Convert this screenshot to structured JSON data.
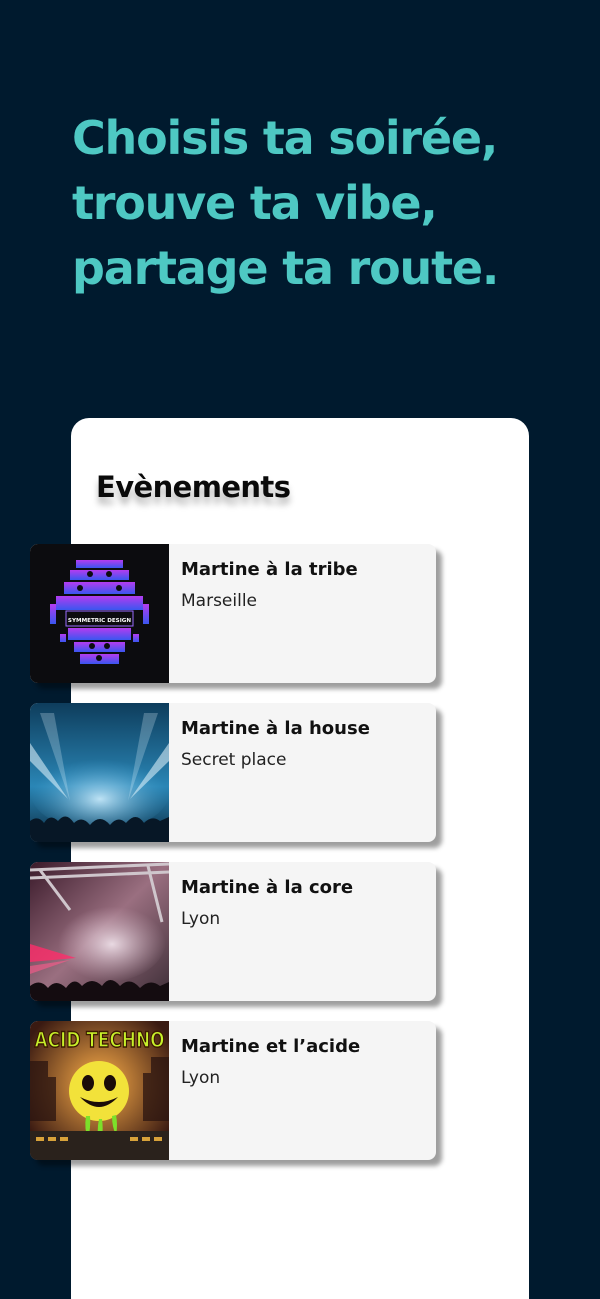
{
  "headline": {
    "line1": "Choisis ta soirée,",
    "line2": "trouve ta vibe,",
    "line3": "partage ta route."
  },
  "panel": {
    "title": "Evènements"
  },
  "events": [
    {
      "name": "Martine à la tribe",
      "city": "Marseille",
      "thumb_text": "SYMMETRIC DESIGN"
    },
    {
      "name": "Martine à la house",
      "city": "Secret place"
    },
    {
      "name": "Martine à la core",
      "city": "Lyon"
    },
    {
      "name": "Martine et l’acide",
      "city": "Lyon",
      "thumb_text": "ACID TECHNO"
    }
  ],
  "colors": {
    "background": "#001a2e",
    "accent": "#4ec8c3",
    "card": "#f5f5f5",
    "panel": "#ffffff"
  }
}
